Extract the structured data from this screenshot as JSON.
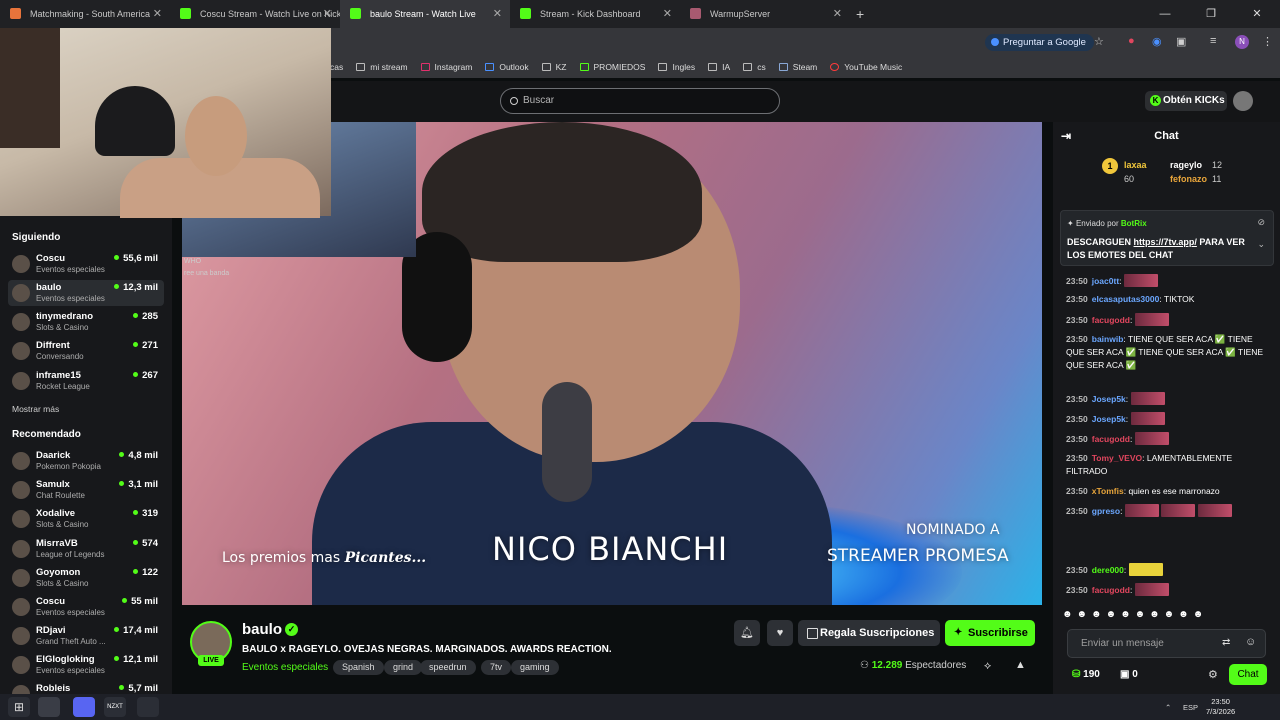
{
  "browser": {
    "tabs": [
      {
        "title": "Matchmaking - South America",
        "color": "#e8743b"
      },
      {
        "title": "Coscu Stream - Watch Live on Kick",
        "color": "#53fc18"
      },
      {
        "title": "baulo Stream - Watch Live",
        "color": "#53fc18"
      },
      {
        "title": "Stream - Kick Dashboard",
        "color": "#53fc18"
      },
      {
        "title": "WarmupServer",
        "color": "#a85a70"
      }
    ],
    "google_button": "Preguntar a Google",
    "profile_initial": "N",
    "bookmarks": [
      "cas",
      "mi stream",
      "Instagram",
      "Outlook",
      "KZ",
      "PROMIEDOS",
      "Ingles",
      "IA",
      "cs",
      "Steam",
      "YouTube Music"
    ]
  },
  "kick": {
    "search_placeholder": "Buscar",
    "kicks_button": "Obtén KICKs",
    "accent": "#53fc18"
  },
  "sidebar": {
    "following_title": "Siguiendo",
    "following": [
      {
        "name": "Coscu",
        "category": "Eventos especiales",
        "viewers": "55,6 mil"
      },
      {
        "name": "baulo",
        "category": "Eventos especiales",
        "viewers": "12,3 mil"
      },
      {
        "name": "tinymedrano",
        "category": "Slots & Casino",
        "viewers": "285"
      },
      {
        "name": "Diffrent",
        "category": "Conversando",
        "viewers": "271"
      },
      {
        "name": "inframe15",
        "category": "Rocket League",
        "viewers": "267"
      }
    ],
    "show_more": "Mostrar más",
    "recommended_title": "Recomendado",
    "recommended": [
      {
        "name": "Daarick",
        "category": "Pokemon Pokopia",
        "viewers": "4,8 mil"
      },
      {
        "name": "Samulx",
        "category": "Chat Roulette",
        "viewers": "3,1 mil"
      },
      {
        "name": "Xodalive",
        "category": "Slots & Casino",
        "viewers": "319"
      },
      {
        "name": "MisrraVB",
        "category": "League of Legends",
        "viewers": "574"
      },
      {
        "name": "Goyomon",
        "category": "Slots & Casino",
        "viewers": "122"
      },
      {
        "name": "Coscu",
        "category": "Eventos especiales",
        "viewers": "55 mil"
      },
      {
        "name": "RDjavi",
        "category": "Grand Theft Auto ...",
        "viewers": "17,4 mil"
      },
      {
        "name": "ElGlogloking",
        "category": "Eventos especiales",
        "viewers": "12,1 mil"
      },
      {
        "name": "Robleis",
        "category": "",
        "viewers": "5,7 mil"
      }
    ]
  },
  "video": {
    "overlay_left": "Los premios mas",
    "overlay_left_em": "Picantes...",
    "overlay_name": "NICO BIANCHI",
    "overlay_nominated": "NOMINADO A",
    "overlay_award": "STREAMER PROMESA",
    "inset_chat": [
      "WHO",
      "ree una banda"
    ]
  },
  "stream": {
    "streamer": "baulo",
    "live_badge": "LIVE",
    "title": "BAULO x RAGEYLO. OVEJAS NEGRAS. MARGINADOS. AWARDS REACTION.",
    "category": "Eventos especiales",
    "tags": [
      "Spanish",
      "grind",
      "speedrun",
      "7tv",
      "gaming"
    ],
    "gift_button": "Regala Suscripciones",
    "subscribe_button": "Suscribirse",
    "viewers_count": "12.289",
    "viewers_label": "Espectadores"
  },
  "chat": {
    "title": "Chat",
    "leaderboard": [
      {
        "name": "laxaa",
        "value": "60"
      },
      {
        "name": "rageylo",
        "value": "12"
      },
      {
        "name": "fefonazo",
        "value": "11"
      }
    ],
    "pinned_by": "Enviado por",
    "pinned_user": "BotRix",
    "pinned_message_pre": "DESCARGUEN",
    "pinned_link": "https://7tv.app/",
    "pinned_message_post": "PARA VER LOS EMOTES DEL CHAT",
    "messages": [
      {
        "time": "23:50",
        "user": "joac0tt",
        "color": "#6ba7ff",
        "text": ""
      },
      {
        "time": "23:50",
        "user": "elcasaputas3000",
        "color": "#6ba7ff",
        "text": "TIKTOK"
      },
      {
        "time": "23:50",
        "user": "facugodd",
        "color": "#e0465e",
        "text": ""
      },
      {
        "time": "23:50",
        "user": "bainwib",
        "color": "#6ba7ff",
        "text": "TIENE QUE SER ACA ✅ TIENE QUE SER ACA ✅ TIENE QUE SER ACA ✅ TIENE QUE SER ACA ✅"
      },
      {
        "time": "23:50",
        "user": "Josep5k",
        "color": "#6ba7ff",
        "text": ""
      },
      {
        "time": "23:50",
        "user": "Josep5k",
        "color": "#6ba7ff",
        "text": ""
      },
      {
        "time": "23:50",
        "user": "facugodd",
        "color": "#e0465e",
        "text": ""
      },
      {
        "time": "23:50",
        "user": "Tomy_VEVO",
        "color": "#e0465e",
        "text": "LAMENTABLEMENTE FILTRADO"
      },
      {
        "time": "23:50",
        "user": "xTomfis",
        "color": "#e8a53b",
        "text": "quien es ese marronazo"
      },
      {
        "time": "23:50",
        "user": "gpreso",
        "color": "#6ba7ff",
        "text": ""
      },
      {
        "time": "23:50",
        "user": "dere000",
        "color": "#53fc18",
        "text": ""
      },
      {
        "time": "23:50",
        "user": "facugodd",
        "color": "#e0465e",
        "text": ""
      }
    ],
    "input_placeholder": "Enviar un mensaje",
    "points": "190",
    "other_points": "0",
    "chat_button": "Chat"
  },
  "taskbar": {
    "lang": "ESP",
    "time": "23:50",
    "date": "7/3/2026"
  }
}
